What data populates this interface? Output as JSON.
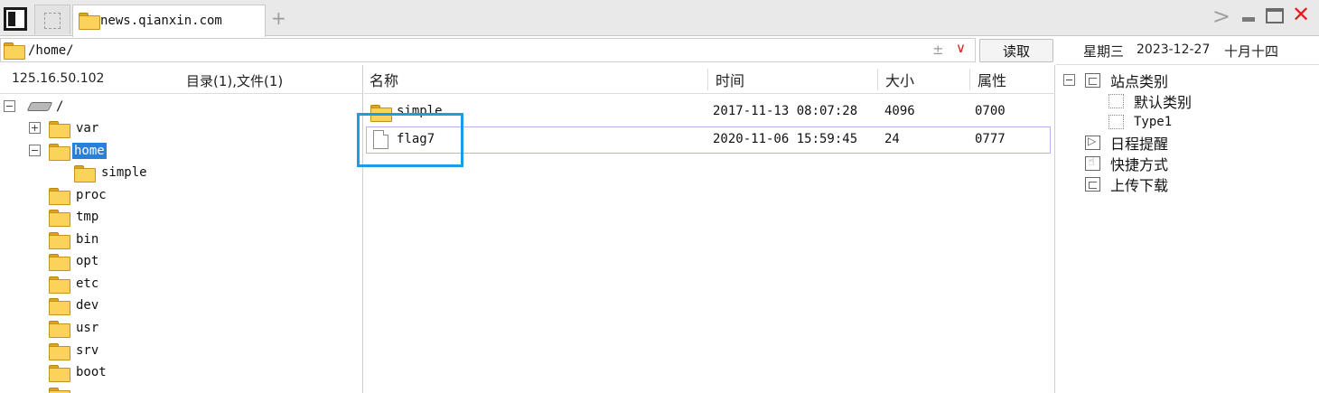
{
  "tabs": [
    {
      "label": "",
      "icon": "blank-page-icon"
    },
    {
      "label": "news.qianxin.com",
      "icon": "folder-icon",
      "active": true
    }
  ],
  "window": {
    "add_tab": "+",
    "next": ">",
    "close": "✕"
  },
  "address": {
    "path": "/home/",
    "plusminus": "±",
    "dropdown": "∨",
    "read_button": "读取"
  },
  "left_panel": {
    "ip": "125.16.50.102",
    "summary": "目录(1),文件(1)",
    "tree": [
      {
        "label": "/",
        "icon": "drive-icon",
        "toggle": "⊟",
        "depth": 0
      },
      {
        "label": "var",
        "toggle": "+",
        "depth": 1
      },
      {
        "label": "home",
        "toggle": "−",
        "depth": 1,
        "selected": true
      },
      {
        "label": "simple",
        "depth": 2
      },
      {
        "label": "proc",
        "depth": 1
      },
      {
        "label": "tmp",
        "depth": 1
      },
      {
        "label": "bin",
        "depth": 1
      },
      {
        "label": "opt",
        "depth": 1
      },
      {
        "label": "etc",
        "depth": 1
      },
      {
        "label": "dev",
        "depth": 1
      },
      {
        "label": "usr",
        "depth": 1
      },
      {
        "label": "srv",
        "depth": 1
      },
      {
        "label": "boot",
        "depth": 1
      }
    ]
  },
  "file_list": {
    "columns": {
      "name": "名称",
      "time": "时间",
      "size": "大小",
      "attr": "属性"
    },
    "rows": [
      {
        "name": "simple",
        "type": "folder",
        "time": "2017-11-13 08:07:28",
        "size": "4096",
        "attr": "0700"
      },
      {
        "name": "flag7",
        "type": "file",
        "time": "2020-11-06 15:59:45",
        "size": "24",
        "attr": "0777"
      }
    ]
  },
  "right_panel": {
    "weekday": "星期三",
    "date": "2023-12-27",
    "lunar": "十月十四",
    "items": [
      {
        "label": "站点类别",
        "icon": "box-icon",
        "toggle": "−",
        "depth": 0
      },
      {
        "label": "默认类别",
        "icon": "dotted-box-icon",
        "depth": 1
      },
      {
        "label": "Type1",
        "icon": "dotted-box-icon",
        "depth": 1
      },
      {
        "label": "日程提醒",
        "icon": "schedule-icon",
        "depth": 0
      },
      {
        "label": "快捷方式",
        "icon": "shortcut-icon",
        "depth": 0
      },
      {
        "label": "上传下载",
        "icon": "box-icon",
        "depth": 0
      }
    ]
  },
  "colors": {
    "selected": "#2a7fd8",
    "focus_box": "#1a9ee3",
    "close": "#e02020"
  }
}
